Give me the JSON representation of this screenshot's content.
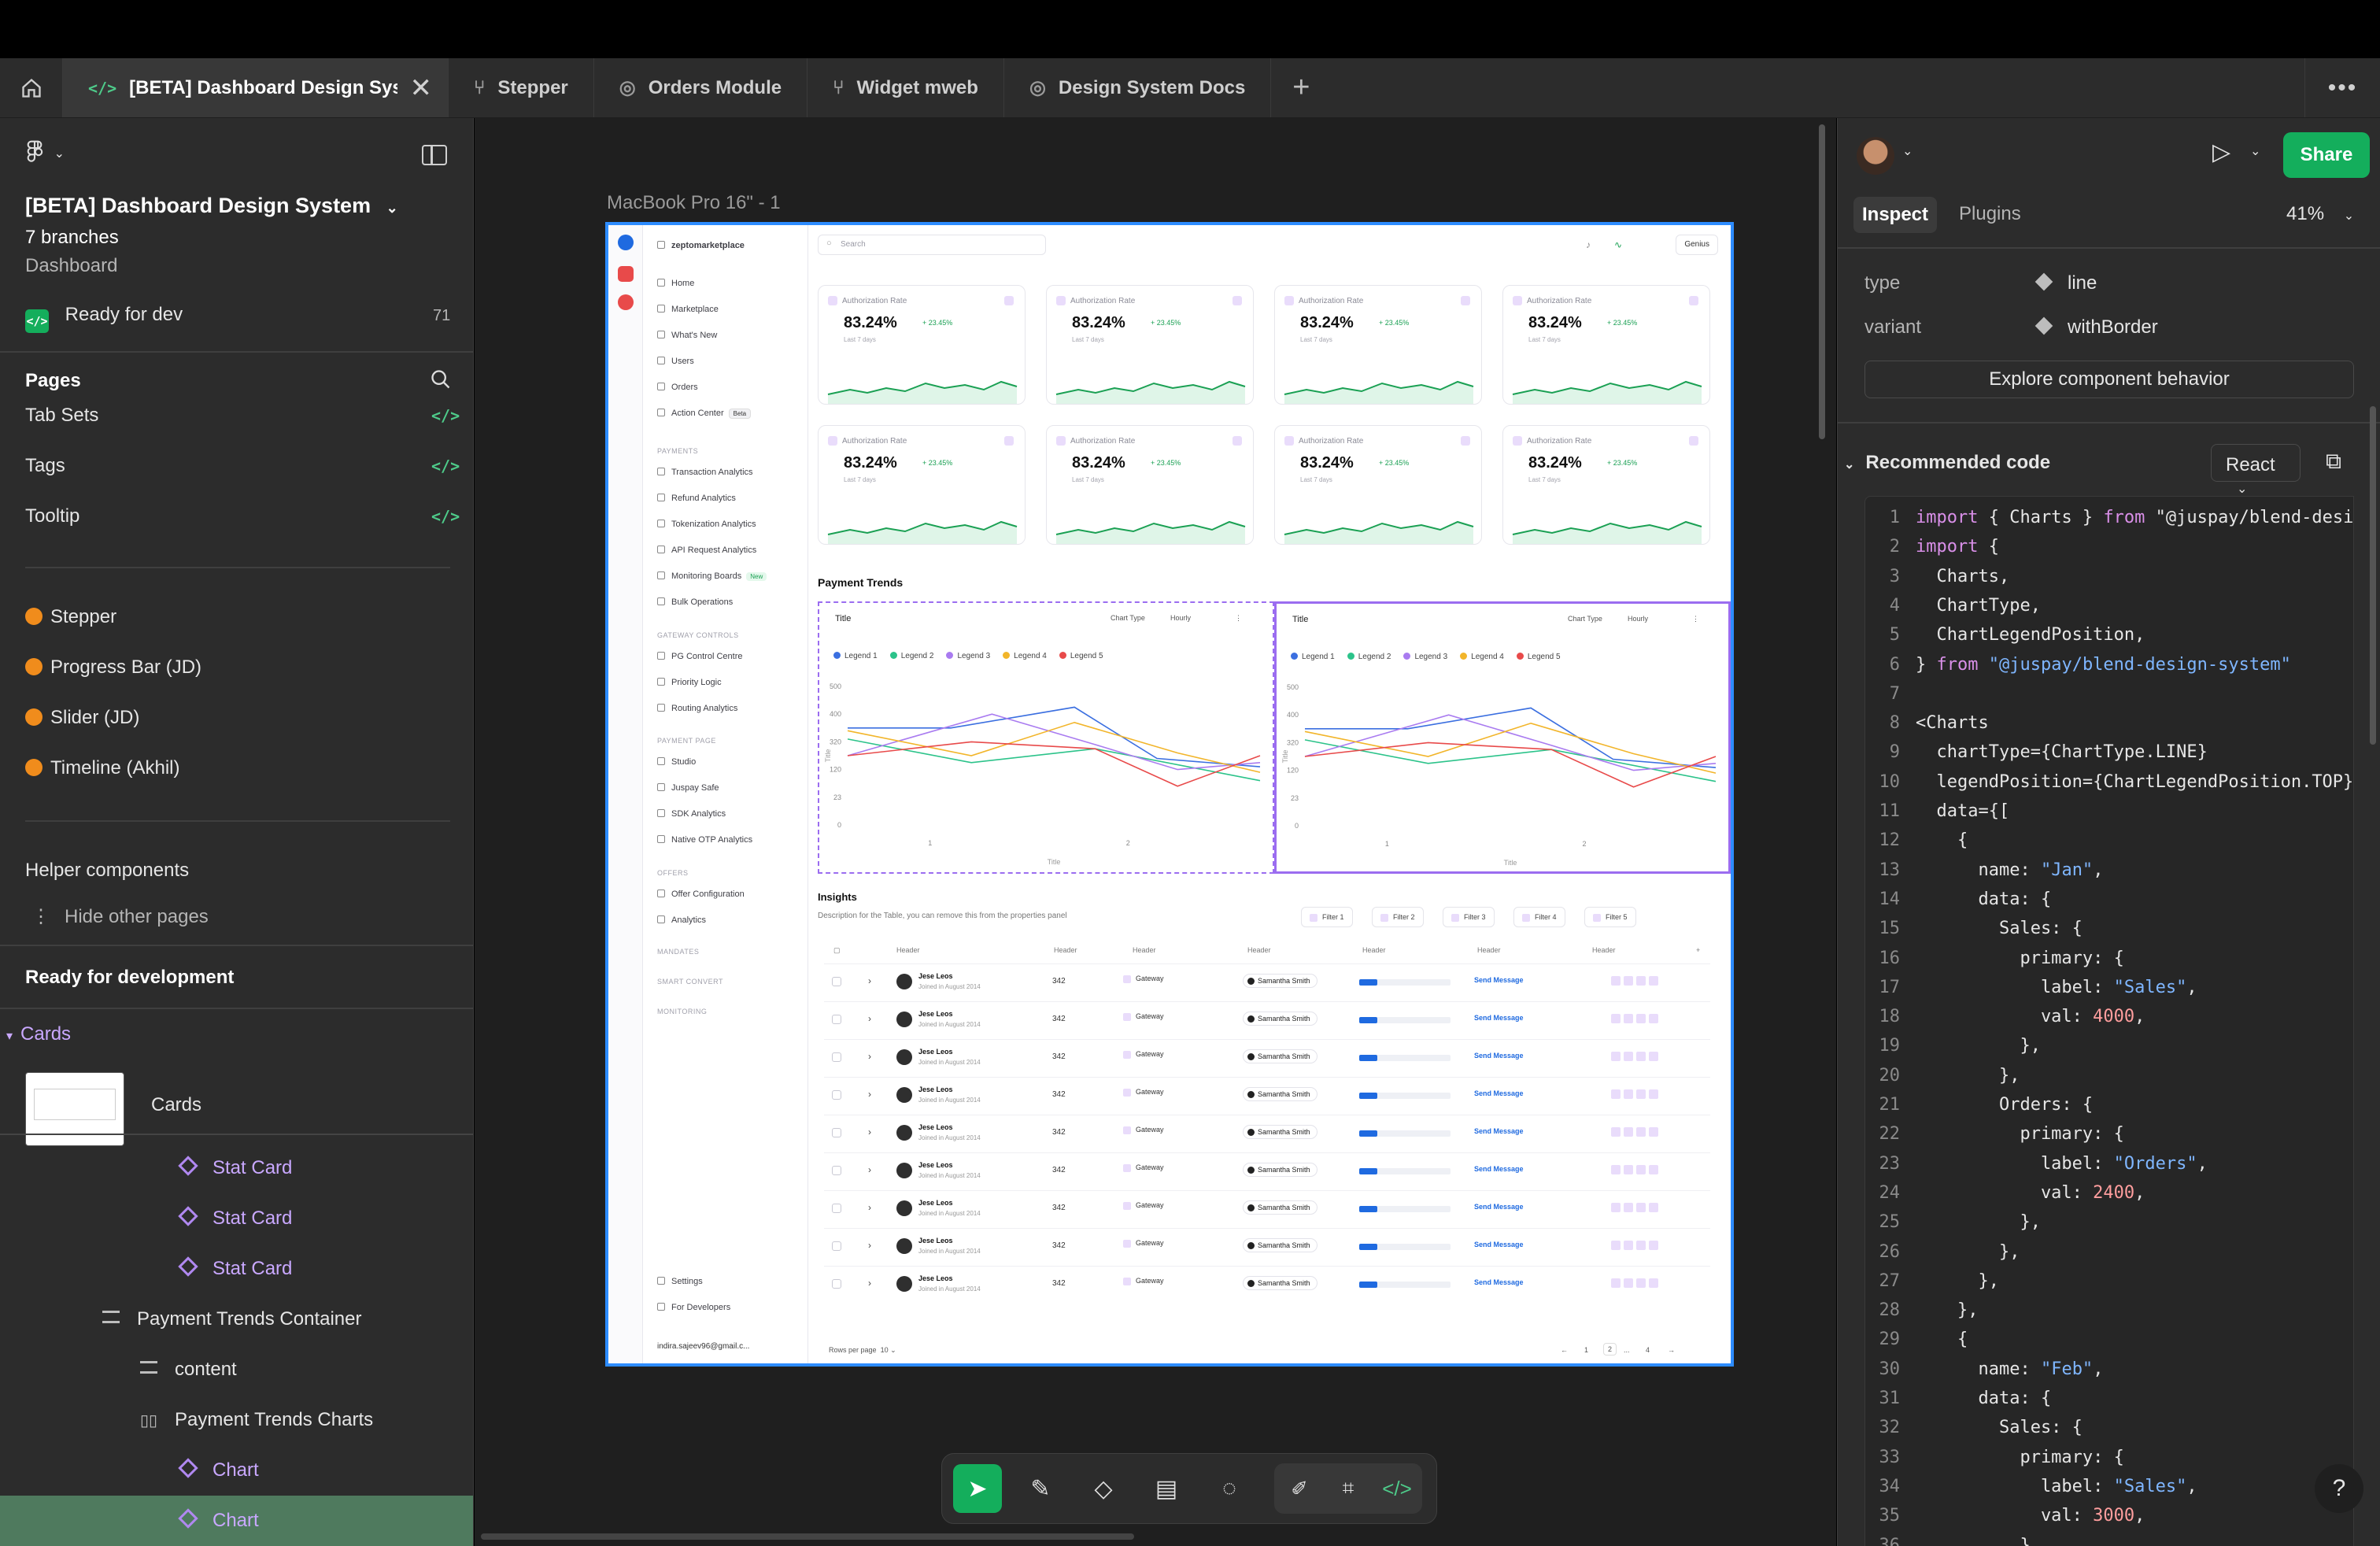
{
  "tabs": [
    {
      "label": "[BETA] Dashboard Design System",
      "active": true,
      "icon": "code-icon"
    },
    {
      "label": "Stepper",
      "icon": "branch-icon"
    },
    {
      "label": "Orders Module",
      "icon": "component-set-icon"
    },
    {
      "label": "Widget mweb",
      "icon": "branch-icon"
    },
    {
      "label": "Design System Docs",
      "icon": "component-set-icon"
    }
  ],
  "left": {
    "file_title": "[BETA] Dashboard Design System",
    "branches": "7 branches",
    "project": "Dashboard",
    "ready_label": "Ready for dev",
    "ready_count": "71",
    "pages_heading": "Pages",
    "pages": [
      "Tab Sets",
      "Tags",
      "Tooltip"
    ],
    "wip_pages": [
      "Stepper",
      "Progress Bar (JD)",
      "Slider (JD)",
      "Timeline (Akhil)"
    ],
    "helper": "Helper components",
    "hide_other": "Hide other pages",
    "ready_for_dev": "Ready for development",
    "cards_section": "Cards",
    "cards_item": "Cards",
    "layers": [
      {
        "label": "Stat Card",
        "type": "instance"
      },
      {
        "label": "Stat Card",
        "type": "instance"
      },
      {
        "label": "Stat Card",
        "type": "instance"
      },
      {
        "label": "Payment Trends Container",
        "type": "frame"
      },
      {
        "label": "content",
        "type": "frame"
      },
      {
        "label": "Payment Trends Charts",
        "type": "frame"
      },
      {
        "label": "Chart",
        "type": "instance"
      },
      {
        "label": "Chart",
        "type": "instance",
        "selected": true
      }
    ]
  },
  "canvas": {
    "frame_label": "MacBook Pro 16\" - 1",
    "dashboard": {
      "workspace": "zeptomarketplace",
      "search_placeholder": "Search",
      "genius": "Genius",
      "nav": [
        "Home",
        "Marketplace",
        "What's New",
        "Users",
        "Orders",
        "Action Center"
      ],
      "beta": "Beta",
      "payments_section": "PAYMENTS",
      "payments": [
        "Transaction Analytics",
        "Refund Analytics",
        "Tokenization Analytics",
        "API Request Analytics",
        "Monitoring Boards",
        "Bulk Operations"
      ],
      "new": "New",
      "gateway_section": "GATEWAY CONTROLS",
      "gateway": [
        "PG Control Centre",
        "Priority Logic",
        "Routing Analytics"
      ],
      "payment_page_section": "PAYMENT PAGE",
      "payment_page": [
        "Studio",
        "Juspay Safe",
        "SDK Analytics",
        "Native OTP Analytics"
      ],
      "offers_section": "OFFERS",
      "offers": [
        "Offer Configuration",
        "Analytics"
      ],
      "mandates": "MANDATES",
      "smart_convert": "SMART CONVERT",
      "monitoring": "MONITORING",
      "settings": "Settings",
      "for_developers": "For Developers",
      "user": "indira.sajeev96@gmail.c...",
      "stat_card": {
        "label": "Authorization Rate",
        "value": "83.24%",
        "delta": "+ 23.45%",
        "sub": "Last 7 days"
      },
      "payment_trends": "Payment Trends",
      "chart_title": "Title",
      "chart_type": "Chart Type",
      "hourly": "Hourly",
      "legends": [
        "Legend 1",
        "Legend 2",
        "Legend 3",
        "Legend 4",
        "Legend 5"
      ],
      "legend_colors": [
        "#3b6fe0",
        "#2cc38a",
        "#a97bf0",
        "#f2b52a",
        "#e84a4a"
      ],
      "y_ticks": [
        "500",
        "400",
        "320",
        "120",
        "23",
        "0"
      ],
      "x_ticks": [
        "1",
        "2"
      ],
      "x_title": "Title",
      "y_title": "Title",
      "insights": "Insights",
      "insights_desc": "Description for the Table, you can remove this from the properties panel",
      "filters": [
        "Filter 1",
        "Filter 2",
        "Filter 3",
        "Filter 4",
        "Filter 5"
      ],
      "header": "Header",
      "row": {
        "name": "Jese Leos",
        "joined": "Joined in August 2014",
        "num": "342",
        "gateway": "Gateway",
        "assignee": "Samantha Smith",
        "action": "Send Message",
        "progress": 0.2
      },
      "rows_per_page": "Rows per page",
      "rows_value": "10",
      "pages": [
        "1",
        "2",
        "...",
        "4"
      ]
    }
  },
  "right": {
    "share": "Share",
    "tab_inspect": "Inspect",
    "tab_plugins": "Plugins",
    "zoom": "41%",
    "prop_type_label": "type",
    "prop_type_value": "line",
    "prop_variant_label": "variant",
    "prop_variant_value": "withBorder",
    "explore": "Explore component behavior",
    "recommended": "Recommended code",
    "framework": "React",
    "code": [
      "import { Charts } from \"@juspay/blend-desig",
      "import {",
      "  Charts,",
      "  ChartType,",
      "  ChartLegendPosition,",
      "} from \"@juspay/blend-design-system\"",
      "",
      "<Charts",
      "  chartType={ChartType.LINE}",
      "  legendPosition={ChartLegendPosition.TOP}",
      "  data={[",
      "    {",
      "      name: \"Jan\",",
      "      data: {",
      "        Sales: {",
      "          primary: {",
      "            label: \"Sales\",",
      "            val: 4000,",
      "          },",
      "        },",
      "        Orders: {",
      "          primary: {",
      "            label: \"Orders\",",
      "            val: 2400,",
      "          },",
      "        },",
      "      },",
      "    },",
      "    {",
      "      name: \"Feb\",",
      "      data: {",
      "        Sales: {",
      "          primary: {",
      "            label: \"Sales\",",
      "            val: 3000,",
      "          },",
      "        }"
    ]
  },
  "toolbar": {
    "help": "?"
  }
}
